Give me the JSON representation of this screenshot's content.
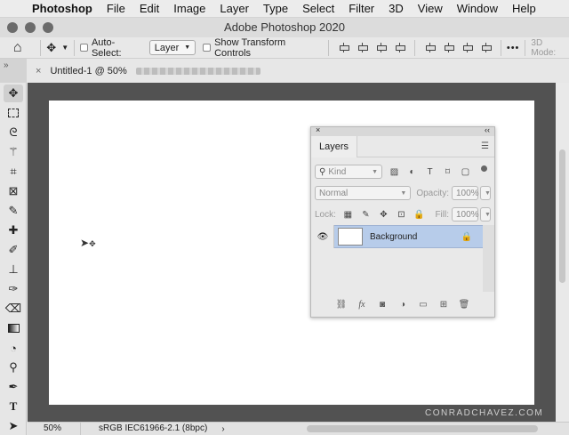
{
  "menubar": {
    "app": "Photoshop",
    "items": [
      "File",
      "Edit",
      "Image",
      "Layer",
      "Type",
      "Select",
      "Filter",
      "3D",
      "View",
      "Window",
      "Help"
    ]
  },
  "window": {
    "title": "Adobe Photoshop 2020"
  },
  "options": {
    "auto_select": "Auto-Select:",
    "layer_select": "Layer",
    "show_transform": "Show Transform Controls",
    "more": "•••",
    "three_d_mode": "3D Mode:"
  },
  "tab": {
    "collapse": "»",
    "close": "×",
    "title": "Untitled-1 @ 50%"
  },
  "panel": {
    "close": "×",
    "collapse": "‹‹",
    "tab": "Layers",
    "menu": "☰",
    "kind": "Kind",
    "blend_mode": "Normal",
    "opacity_label": "Opacity:",
    "opacity_value": "100%",
    "lock_label": "Lock:",
    "fill_label": "Fill:",
    "fill_value": "100%",
    "layer_name": "Background"
  },
  "status": {
    "zoom": "50%",
    "profile": "sRGB IEC61966-2.1 (8bpc)",
    "chevron": "›"
  },
  "watermark": "CONRADCHAVEZ.COM",
  "icons": {
    "apple": "",
    "home": "⌂",
    "move": "✥",
    "eye": "👁",
    "lock": "🔒"
  }
}
